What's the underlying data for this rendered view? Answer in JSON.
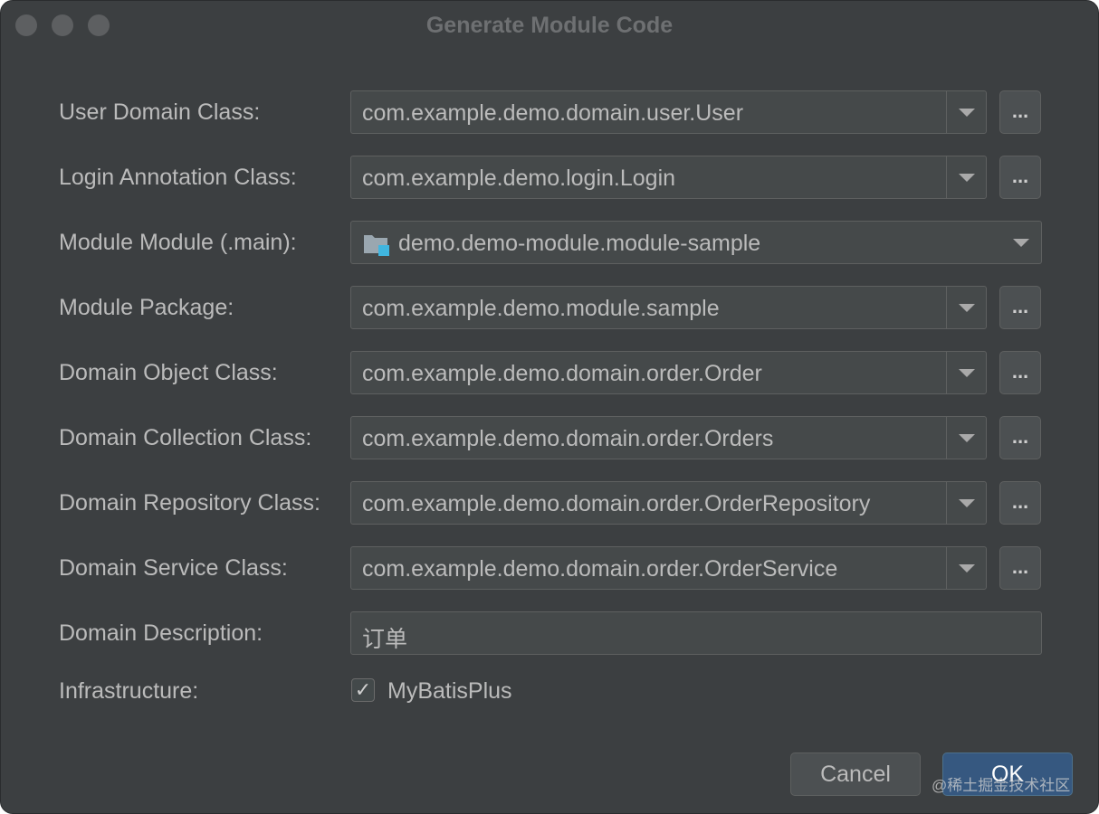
{
  "window": {
    "title": "Generate Module Code"
  },
  "fields": [
    {
      "label": "User Domain Class:",
      "value": "com.example.demo.domain.user.User",
      "browse": "..."
    },
    {
      "label": "Login Annotation Class:",
      "value": "com.example.demo.login.Login",
      "browse": "..."
    },
    {
      "label": "Module Module (.main):",
      "value": "demo.demo-module.module-sample",
      "icon": "module-folder-icon"
    },
    {
      "label": "Module Package:",
      "value": "com.example.demo.module.sample",
      "browse": "..."
    },
    {
      "label": "Domain Object Class:",
      "value": "com.example.demo.domain.order.Order",
      "browse": "..."
    },
    {
      "label": "Domain Collection Class:",
      "value": "com.example.demo.domain.order.Orders",
      "browse": "..."
    },
    {
      "label": "Domain Repository Class:",
      "value": "com.example.demo.domain.order.OrderRepository",
      "browse": "..."
    },
    {
      "label": "Domain Service Class:",
      "value": "com.example.demo.domain.order.OrderService",
      "browse": "..."
    }
  ],
  "description": {
    "label": "Domain Description:",
    "value": "订单"
  },
  "infrastructure": {
    "label": "Infrastructure:",
    "option": "MyBatisPlus",
    "checked": true,
    "checkmark": "✓"
  },
  "buttons": {
    "cancel": "Cancel",
    "ok": "OK"
  },
  "watermark": "@稀土掘金技术社区",
  "colors": {
    "background": "#3c3f41",
    "field": "#45494a",
    "text": "#bbbbbb",
    "accent": "#365880"
  }
}
